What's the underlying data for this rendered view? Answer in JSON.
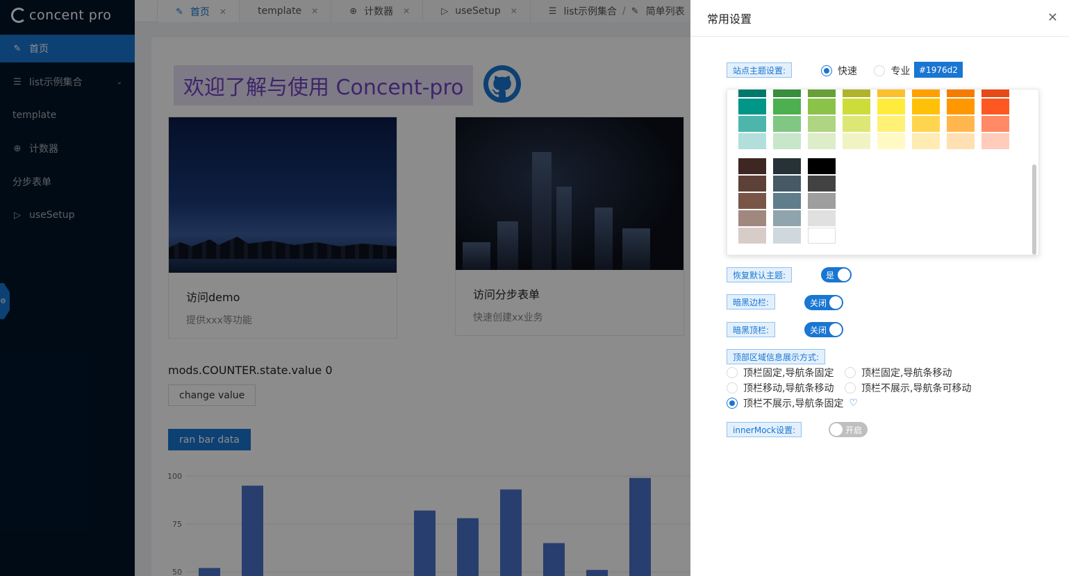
{
  "sidebar": {
    "logo": "concent pro",
    "items": [
      {
        "label": "首页",
        "icon": "edit-icon",
        "active": true
      },
      {
        "label": "list示例集合",
        "icon": "list-icon",
        "expandable": true
      },
      {
        "label": "template",
        "icon": ""
      },
      {
        "label": "计数器",
        "icon": "plus-circle-icon"
      },
      {
        "label": "分步表单",
        "icon": ""
      },
      {
        "label": "useSetup",
        "icon": "play-circle-icon"
      }
    ]
  },
  "tabs": [
    {
      "label": "首页",
      "icon": "edit-icon",
      "active": true
    },
    {
      "label": "template",
      "icon": ""
    },
    {
      "label": "计数器",
      "icon": "plus-circle-icon"
    },
    {
      "label": "useSetup",
      "icon": "play-circle-icon"
    },
    {
      "label": "list示例集合",
      "crumb": "简单列表",
      "icon": "list-icon"
    }
  ],
  "main": {
    "welcome": "欢迎了解与使用 Concent-pro",
    "cards": [
      {
        "title": "访问demo",
        "desc": "提供xxx等功能"
      },
      {
        "title": "访问分步表单",
        "desc": "快速创建xx业务"
      }
    ],
    "counter_text": "mods.COUNTER.state.value 0",
    "change_button": "change value",
    "ran_button": "ran bar data"
  },
  "chart_data": {
    "type": "bar",
    "y_ticks": [
      "100",
      "75",
      "50"
    ],
    "ylim": [
      50,
      100
    ],
    "values": [
      52,
      95,
      0,
      0,
      0,
      82,
      78,
      93,
      65,
      51,
      99
    ],
    "color": "#4a72c9"
  },
  "drawer": {
    "title": "常用设置",
    "theme_label": "站点主题设置:",
    "theme_options": [
      "快速",
      "专业"
    ],
    "theme_selected": "快速",
    "theme_color": "#1976d2",
    "reset_label": "恢复默认主题:",
    "reset_switch": "是",
    "dark_side_label": "暗黑边栏:",
    "dark_side_switch": "关闭",
    "dark_top_label": "暗黑顶栏:",
    "dark_top_switch": "关闭",
    "top_area_label": "顶部区域信息展示方式:",
    "top_area_options": [
      "顶栏固定,导航条固定",
      "顶栏固定,导航条移动",
      "顶栏移动,导航条移动",
      "顶栏不展示,导航条可移动",
      "顶栏不展示,导航条固定"
    ],
    "top_area_selected": "顶栏不展示,导航条固定",
    "mock_label": "innerMock设置:",
    "mock_switch": "开启"
  },
  "palette": {
    "columns_top": [
      [
        "#00796b",
        "#009688",
        "#4db6ac",
        "#b2dfdb"
      ],
      [
        "#388e3c",
        "#4caf50",
        "#81c784",
        "#c8e6c9"
      ],
      [
        "#689f38",
        "#8bc34a",
        "#aed581",
        "#dcedc8"
      ],
      [
        "#afb42b",
        "#cddc39",
        "#dce775",
        "#f0f4c3"
      ],
      [
        "#fbc02d",
        "#ffeb3b",
        "#fff176",
        "#fff9c4"
      ],
      [
        "#ffa000",
        "#ffc107",
        "#ffd54f",
        "#ffecb3"
      ],
      [
        "#f57c00",
        "#ff9800",
        "#ffb74d",
        "#ffe0b2"
      ],
      [
        "#e64a19",
        "#ff5722",
        "#ff8a65",
        "#ffccbc"
      ]
    ],
    "columns_bottom": [
      [
        "#3e2723",
        "#5d4037",
        "#795548",
        "#a1887f",
        "#d7ccc8"
      ],
      [
        "#263238",
        "#455a64",
        "#607d8b",
        "#90a4ae",
        "#cfd8dc"
      ],
      [
        "#000000",
        "#424242",
        "#9e9e9e",
        "#e0e0e0",
        "#ffffff"
      ]
    ]
  }
}
